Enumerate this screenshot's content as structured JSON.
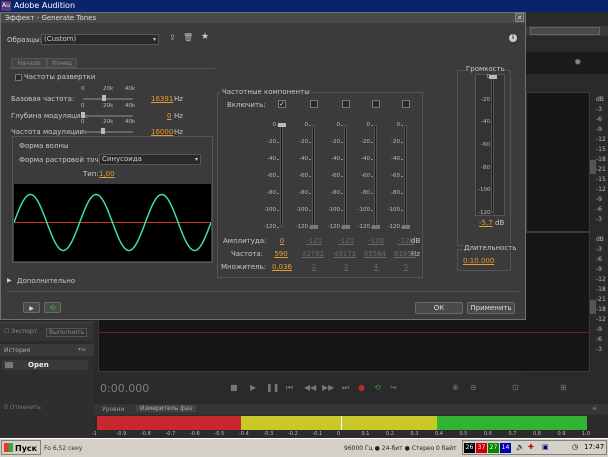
{
  "app": {
    "title": "Adobe Audition",
    "logo": "Au"
  },
  "dialog": {
    "title": "Эффект - Generate Tones",
    "presets_label": "Образцы:",
    "preset_value": "(Custom)",
    "tabs": [
      "Начало",
      "Конец"
    ],
    "sweep_label": "Частоты развертки",
    "slider_ticks": [
      "0",
      "20k",
      "40k"
    ],
    "params": [
      {
        "label": "Базовая частота:",
        "value": "16391",
        "unit": "Hz",
        "pos": 0.41
      },
      {
        "label": "Глубина модуляции:",
        "value": "0",
        "unit": "Hz",
        "pos": 0.0
      },
      {
        "label": "Частота модуляции:",
        "value": "16000",
        "unit": "Hz",
        "pos": 0.4
      }
    ],
    "waveform": {
      "section": "Форма волны",
      "shape_label": "Форма растровой точки:",
      "shape_value": "Синусоида",
      "type_label": "Тип:",
      "type_value": "1,00"
    },
    "components": {
      "title": "Частотные компоненты",
      "enable_label": "Включить:",
      "enabled": [
        true,
        false,
        false,
        false,
        false
      ],
      "db_ticks": [
        "0",
        "-20",
        "-40",
        "-60",
        "-80",
        "-100",
        "-120"
      ],
      "amplitude_label": "Амплитуда:",
      "amplitudes": [
        "0",
        "-120",
        "-120",
        "-120",
        "-120"
      ],
      "amp_unit": "dB",
      "frequency_label": "Частота:",
      "frequencies": [
        "590",
        "32782",
        "49173",
        "65564",
        "81955"
      ],
      "freq_unit": "Hz",
      "multiplier_label": "Множитель:",
      "multipliers": [
        "0,036",
        "2",
        "3",
        "4",
        "5"
      ]
    },
    "volume": {
      "title": "Громкость",
      "ticks": [
        "0",
        "-20",
        "-40",
        "-60",
        "-80",
        "-100",
        "-120"
      ],
      "value": "-5,7",
      "unit": "dB"
    },
    "duration": {
      "title": "Длительность",
      "value": "0:10.000"
    },
    "advanced_label": "Дополнительно",
    "ok_label": "ОК",
    "apply_label": "Применить"
  },
  "background": {
    "db_scale_right": [
      "dB",
      "-3",
      "-6",
      "-9",
      "-12",
      "-15",
      "-18",
      "-21",
      "-15",
      "-12",
      "-9",
      "-6",
      "-3"
    ],
    "db_scale_right2": [
      "dB",
      "-3",
      "-6",
      "-9",
      "-12",
      "-18",
      "-21",
      "-18",
      "-12",
      "-9",
      "-6",
      "-3"
    ],
    "export_label": "Экспорт",
    "run_label": "Выполнить",
    "history_tab": "История",
    "history_item": "Open",
    "undo_label": "0 Отменить",
    "time": "0:00.000",
    "levels_tab": "Уровни",
    "freq_meter_tab": "Измеритель фаз",
    "meter_ticks": [
      "-1",
      "-0.9",
      "-0.8",
      "-0.7",
      "-0.6",
      "-0.5",
      "-0.4",
      "-0.3",
      "-0.2",
      "-0.1",
      "0",
      "0.1",
      "0.2",
      "0.3",
      "0.4",
      "0.5",
      "0.6",
      "0.7",
      "0.8",
      "0.9",
      "1.0"
    ],
    "status": "96000 Гц ● 24-бит ● Стерео",
    "status_left": "Fo 6,52 секу",
    "status_right": "0 байт"
  },
  "taskbar": {
    "start_label": "Пуск",
    "clock": "17:47",
    "tray_nums": [
      "26",
      "37",
      "27",
      "14"
    ]
  },
  "colors": {
    "accent": "#e89b2d",
    "wave": "#3de0a0",
    "centerline": "#c83232",
    "meter_red": "#c8282d",
    "meter_yellow": "#c8c828",
    "meter_green": "#32b432"
  }
}
